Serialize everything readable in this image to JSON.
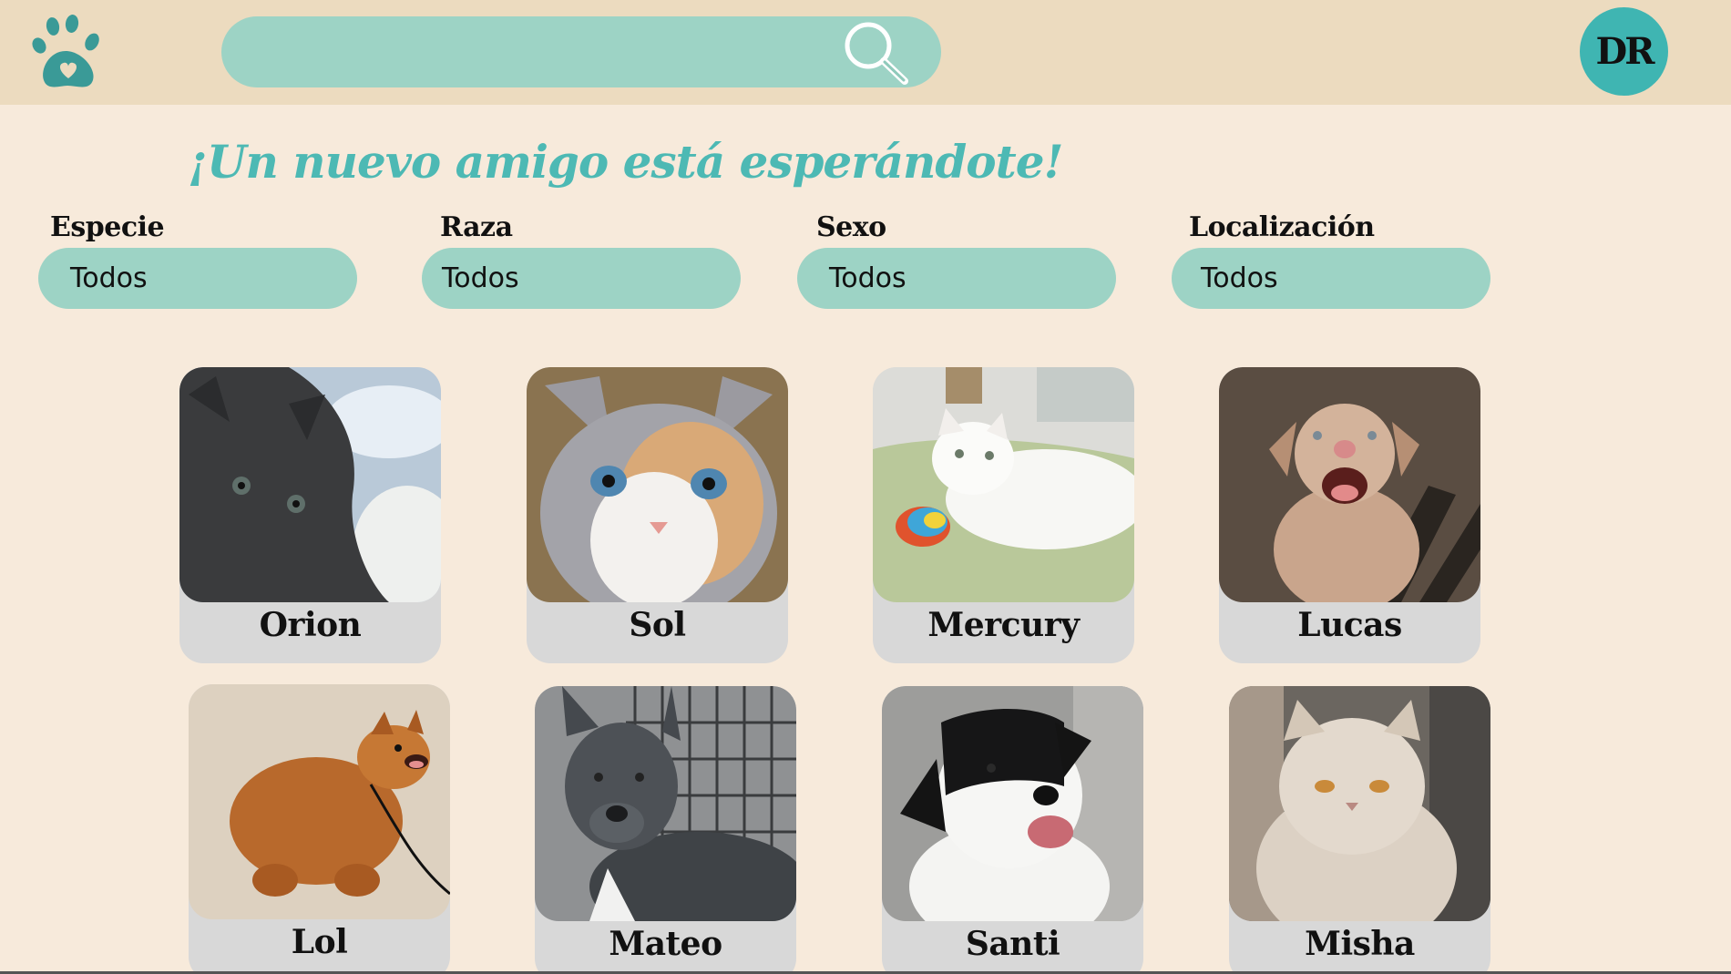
{
  "header": {
    "logo_icon": "paw-heart-icon",
    "search": {
      "value": "",
      "placeholder": "",
      "icon": "magnifier-icon"
    },
    "avatar_initials": "DR"
  },
  "main": {
    "headline": "¡Un nuevo amigo está esperándote!",
    "filters": [
      {
        "label": "Especie",
        "value": "Todos"
      },
      {
        "label": "Raza",
        "value": "Todos"
      },
      {
        "label": "Sexo",
        "value": "Todos"
      },
      {
        "label": "Localización",
        "value": "Todos"
      }
    ],
    "pets": [
      {
        "name": "Orion"
      },
      {
        "name": "Sol"
      },
      {
        "name": "Mercury"
      },
      {
        "name": "Lucas"
      },
      {
        "name": "Lol"
      },
      {
        "name": "Mateo"
      },
      {
        "name": "Santi"
      },
      {
        "name": "Misha"
      }
    ]
  },
  "colors": {
    "page_bg": "#f7eadb",
    "topbar_bg": "#ecdbbf",
    "accent_teal": "#9dd3c5",
    "headline_teal": "#4db9b4",
    "avatar_teal": "#3fb5b2",
    "card_gray": "#d8d8d8"
  }
}
